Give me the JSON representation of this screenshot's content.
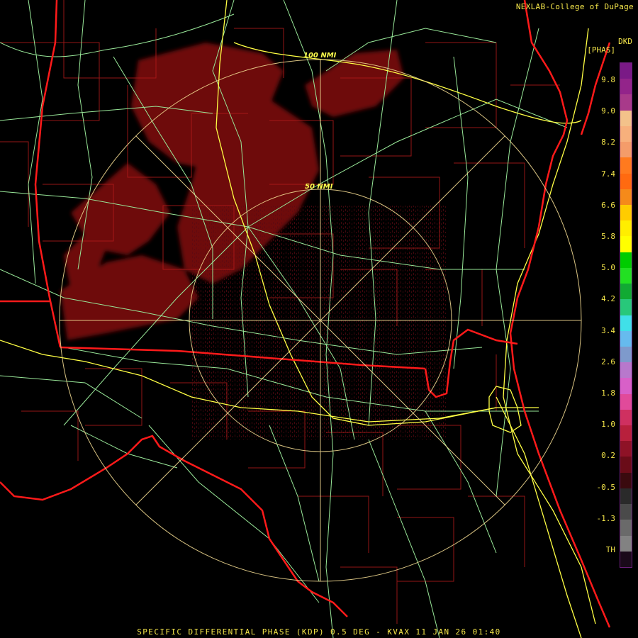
{
  "header": {
    "credit": "NEXLAB-College of DuPage",
    "unit_line1": "DKD",
    "unit_line2": "[PHAS]"
  },
  "footer": {
    "caption": "SPECIFIC DIFFERENTIAL PHASE (KDP) 0.5 DEG - KVAX 11 JAN 26 01:40"
  },
  "range_rings": [
    {
      "label": "100 NMI"
    },
    {
      "label": "50 NMI"
    }
  ],
  "legend": {
    "ticks": [
      "9.8",
      "9.0",
      "8.2",
      "7.4",
      "6.6",
      "5.8",
      "5.0",
      "4.2",
      "3.4",
      "2.6",
      "1.8",
      "1.0",
      "0.2",
      "-0.5",
      "-1.3",
      "TH"
    ],
    "colors": [
      "#7a1a86",
      "#93248a",
      "#a83a8a",
      "#f3c28a",
      "#f7b07c",
      "#f49c6a",
      "#ff7a1e",
      "#ff6a10",
      "#f58a1a",
      "#ffcc00",
      "#ffee00",
      "#ffff00",
      "#00cc00",
      "#22e022",
      "#11aa33",
      "#28c87a",
      "#40e0e8",
      "#66bbee",
      "#7e9acc",
      "#b878cc",
      "#d860c8",
      "#e14a9a",
      "#cf3060",
      "#b8203c",
      "#8e1226",
      "#6a0c18",
      "#3a0a0e",
      "#2a2a2a",
      "#4a4a4a",
      "#6a6a6a",
      "#828282",
      "#1a0a1a"
    ]
  },
  "colors": {
    "state_border": "#ff1a1a",
    "county_border": "#b01a1a",
    "highway": "#ffff44",
    "road": "#99e899",
    "range_ring": "#f0d890",
    "echo": "#7a0a10"
  }
}
